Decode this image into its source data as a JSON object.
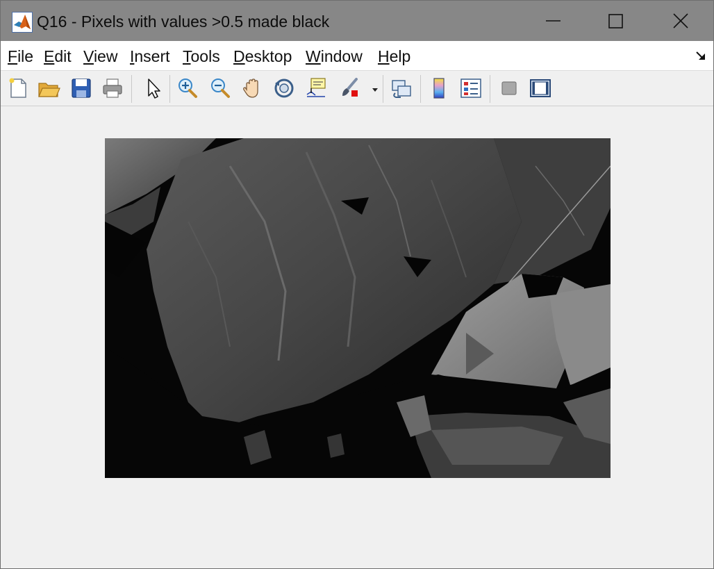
{
  "window": {
    "title": "Q16 - Pixels with values >0.5 made black",
    "controls": {
      "minimize": "minimize",
      "maximize": "maximize",
      "close": "close"
    }
  },
  "menu": {
    "items": [
      {
        "key": "F",
        "rest": "ile"
      },
      {
        "key": "E",
        "rest": "dit"
      },
      {
        "key": "V",
        "rest": "iew"
      },
      {
        "key": "I",
        "rest": "nsert"
      },
      {
        "key": "T",
        "rest": "ools"
      },
      {
        "key": "D",
        "rest": "esktop"
      },
      {
        "key": "W",
        "rest": "indow"
      },
      {
        "key": "H",
        "rest": "elp"
      }
    ]
  },
  "toolbar": {
    "icons": [
      "new-figure-icon",
      "open-file-icon",
      "save-figure-icon",
      "print-figure-icon",
      "edit-plot-icon",
      "zoom-in-icon",
      "zoom-out-icon",
      "pan-icon",
      "rotate-3d-icon",
      "data-cursor-icon",
      "brush-icon",
      "link-plot-icon",
      "insert-colorbar-icon",
      "insert-legend-icon",
      "hide-plot-tools-icon",
      "show-plot-tools-icon"
    ]
  },
  "figure": {
    "image_description": "grayscale photo of a rock face with a tent, bright pixels shown as black"
  }
}
